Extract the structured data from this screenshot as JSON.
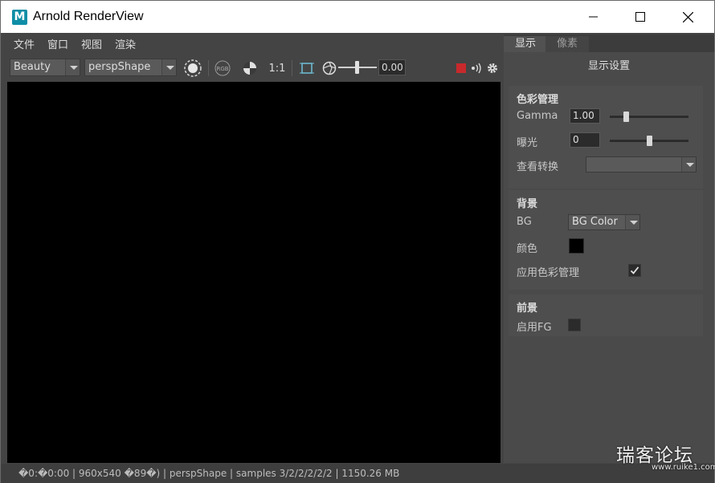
{
  "window": {
    "title": "Arnold RenderView",
    "logo_letter": "M"
  },
  "menu": [
    "文件",
    "窗口",
    "视图",
    "渲染"
  ],
  "toolbar": {
    "aov": "Beauty",
    "camera": "perspShape",
    "rgb_label": "RGB",
    "ratio": "1:1",
    "exposure_value": "0.00"
  },
  "side_panel": {
    "tabs": [
      "显示",
      "像素"
    ],
    "title": "显示设置",
    "color_management": {
      "header": "色彩管理",
      "gamma_label": "Gamma",
      "gamma_value": "1.00",
      "gamma_slider": 0.2,
      "exposure_label": "曝光",
      "exposure_value": "0",
      "exposure_slider": 0.5,
      "view_transform_label": "查看转换",
      "view_transform_value": ""
    },
    "background": {
      "header": "背景",
      "bg_label": "BG",
      "bg_value": "BG Color",
      "color_label": "颜色",
      "color_value": "#000000",
      "apply_cm_label": "应用色彩管理",
      "apply_cm_checked": true
    },
    "foreground": {
      "header": "前景",
      "enable_fg_label": "启用FG",
      "enable_fg_checked": false
    }
  },
  "status": {
    "text": "�0:�0:00 | 960x540 �89�) | perspShape  | samples 3/2/2/2/2/2 | 1150.26 MB"
  },
  "watermark": {
    "main": "瑞客论坛",
    "url": "www.ruike1.com"
  },
  "colors": {
    "stop_button": "#c8292c",
    "viewport": "#000000"
  }
}
